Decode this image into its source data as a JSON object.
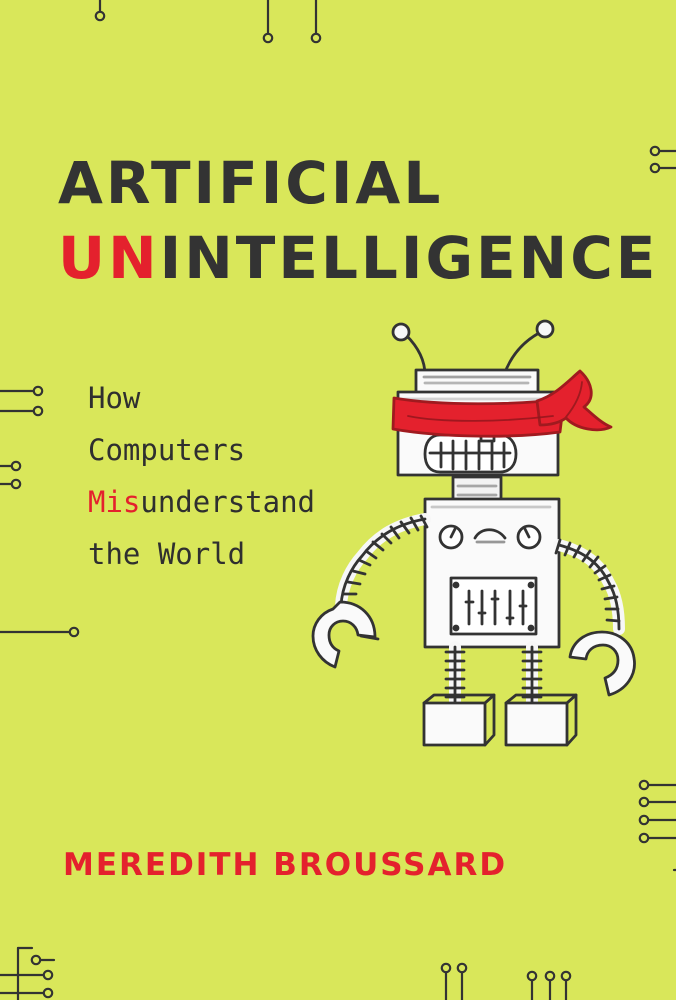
{
  "book": {
    "title_line_1": "ARTIFICIAL",
    "title_line_2_prefix": "UN",
    "title_line_2_rest": "INTELLIGENCE",
    "subtitle_line_1": "How",
    "subtitle_line_2": "Computers",
    "subtitle_line_3_prefix": "Mis",
    "subtitle_line_3_rest": "understand",
    "subtitle_line_4": "the World",
    "author": "MEREDITH BROUSSARD"
  },
  "theme": {
    "background": "#d9e75a",
    "accent": "#e4212d",
    "ink": "#333333"
  },
  "illustration": {
    "subject": "robot-icon",
    "blindfold_color": "#e4212d"
  }
}
